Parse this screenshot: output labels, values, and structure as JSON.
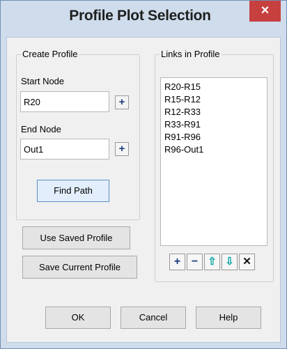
{
  "window": {
    "title": "Profile Plot Selection",
    "close_glyph": "×"
  },
  "create_profile": {
    "group_label": "Create Profile",
    "start_node_label": "Start Node",
    "start_node_value": "R20",
    "end_node_label": "End Node",
    "end_node_value": "Out1",
    "add_glyph": "+",
    "find_path_label": "Find Path"
  },
  "profile_buttons": {
    "use_saved_label": "Use Saved Profile",
    "save_current_label": "Save Current Profile"
  },
  "links": {
    "group_label": "Links in Profile",
    "items": [
      "R20-R15",
      "R15-R12",
      "R12-R33",
      "R33-R91",
      "R91-R96",
      "R96-Out1"
    ],
    "toolbar": {
      "add": "+",
      "remove": "−",
      "up": "⇧",
      "down": "⇩",
      "delete": "✕"
    }
  },
  "footer": {
    "ok_label": "OK",
    "cancel_label": "Cancel",
    "help_label": "Help"
  },
  "colors": {
    "title_bg": "#cfdcec",
    "close_bg": "#c74040",
    "arrow_teal": "#0aa3a3",
    "plus_blue": "#1a3c80"
  },
  "icons": [
    "close-icon",
    "plus-icon",
    "minus-icon",
    "arrow-up-icon",
    "arrow-down-icon",
    "delete-icon"
  ]
}
